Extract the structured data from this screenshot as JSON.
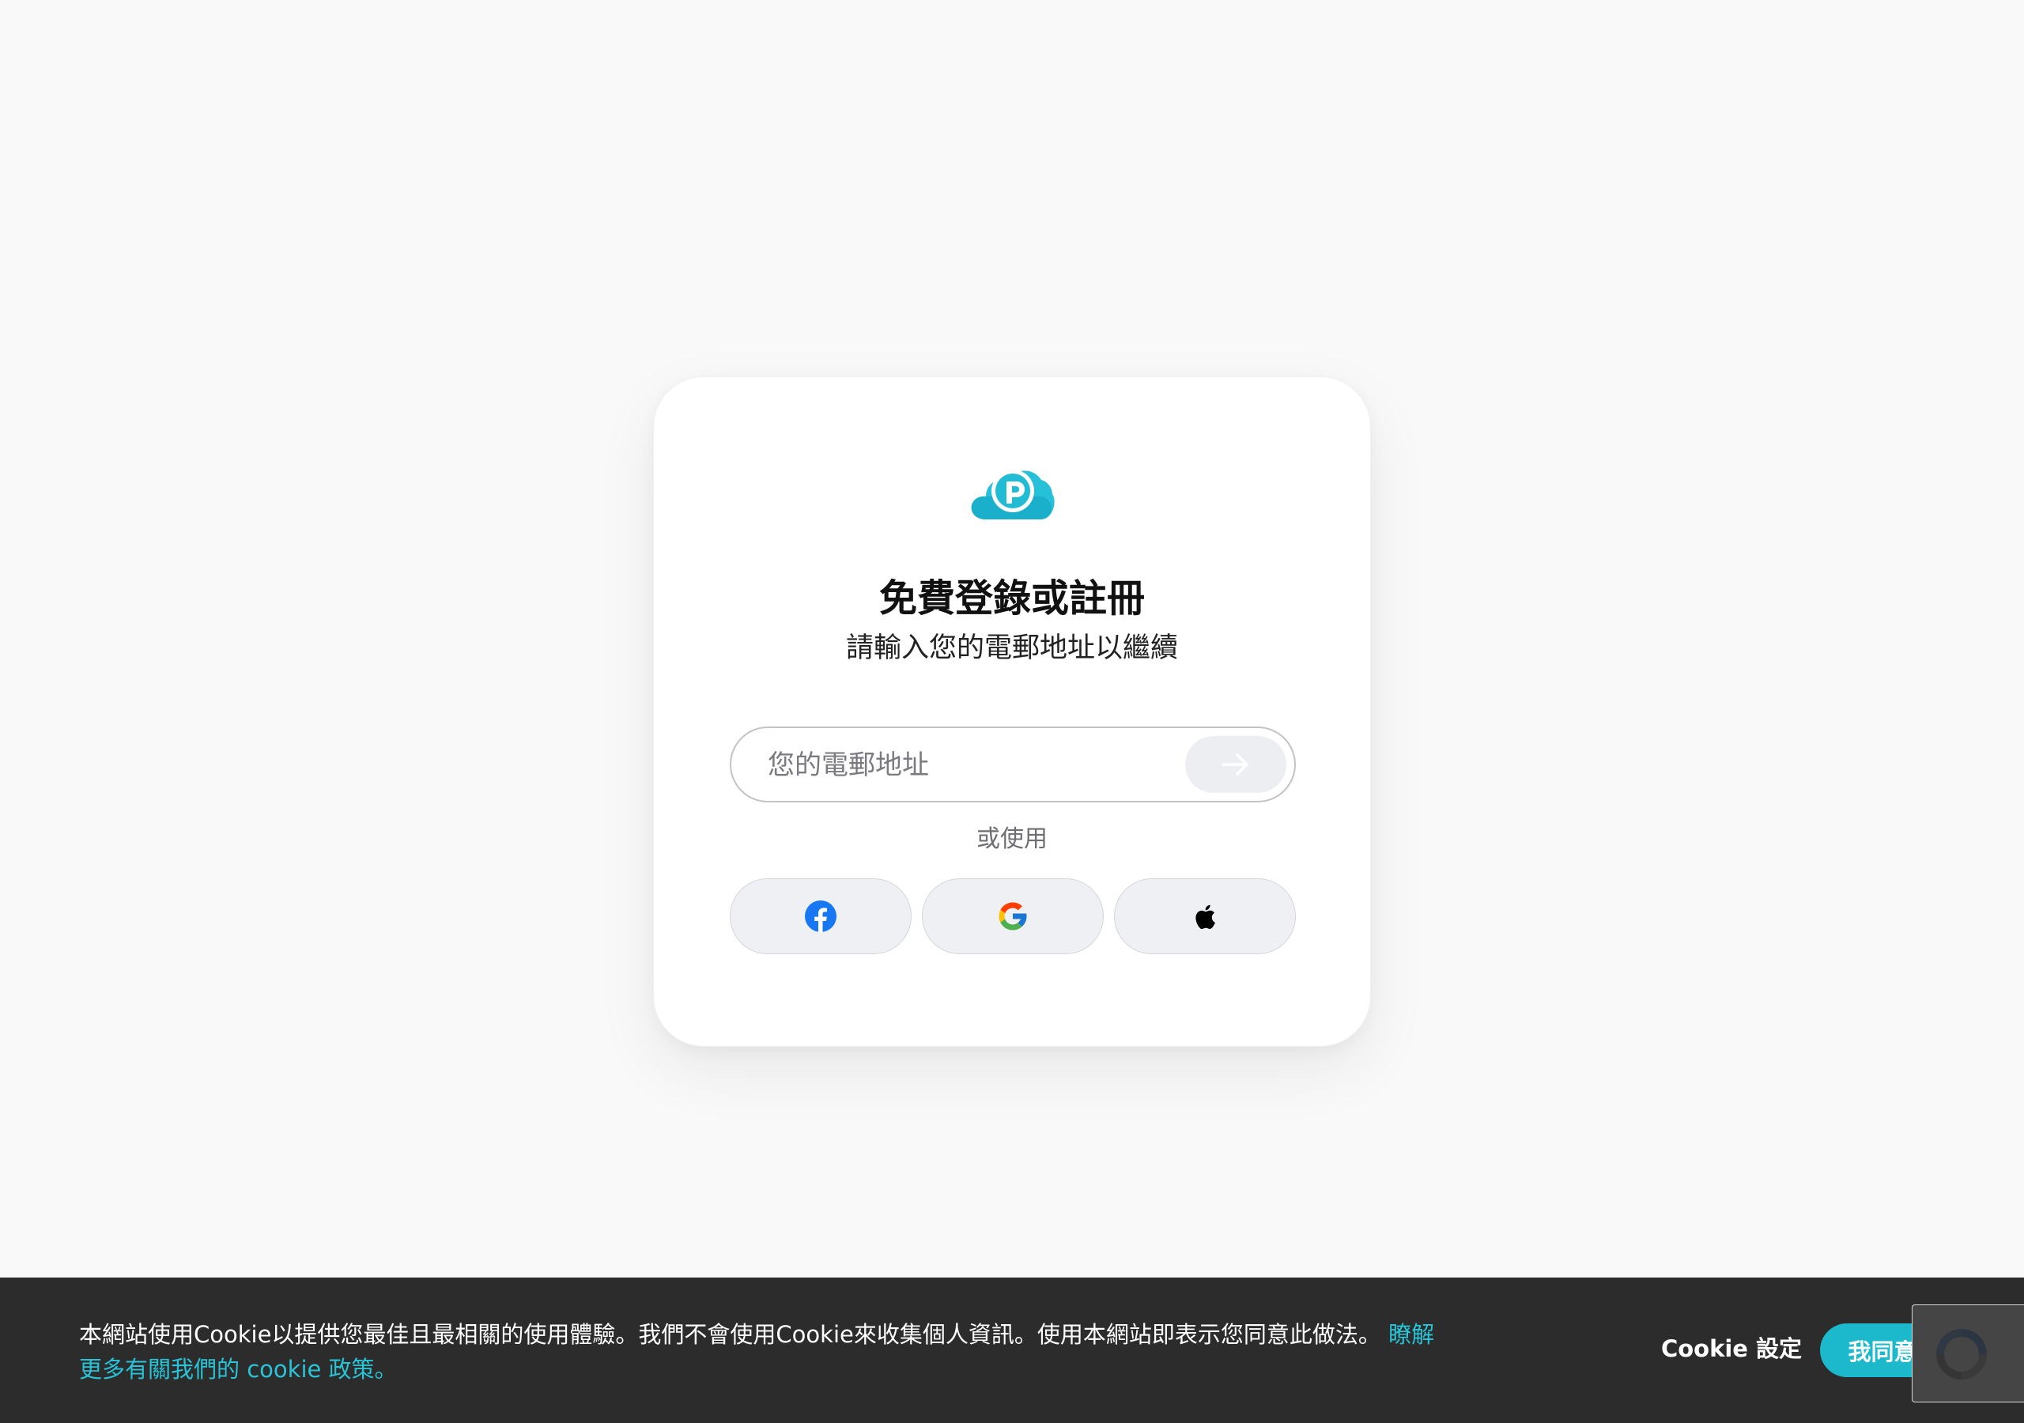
{
  "login": {
    "title": "免費登錄或註冊",
    "subtitle": "請輸入您的電郵地址以繼續",
    "email_placeholder": "您的電郵地址",
    "email_value": "",
    "or_label": "或使用",
    "social_buttons": [
      "facebook-icon",
      "google-icon",
      "apple-icon"
    ]
  },
  "brand": {
    "logo": "pcloud-logo-icon",
    "accent_color": "#1cb8cc"
  },
  "cookie": {
    "text": "本網站使用Cookie以提供您最佳且最相關的使用體驗。我們不會使用Cookie來收集個人資訊。使用本網站即表示您同意此做法。",
    "link_text": "瞭解更多有關我們的 cookie 政策。",
    "settings_label": "Cookie 設定",
    "agree_label": "我同意",
    "background_color": "#2c2c2c"
  },
  "recaptcha": {
    "icon": "recaptcha-icon"
  }
}
